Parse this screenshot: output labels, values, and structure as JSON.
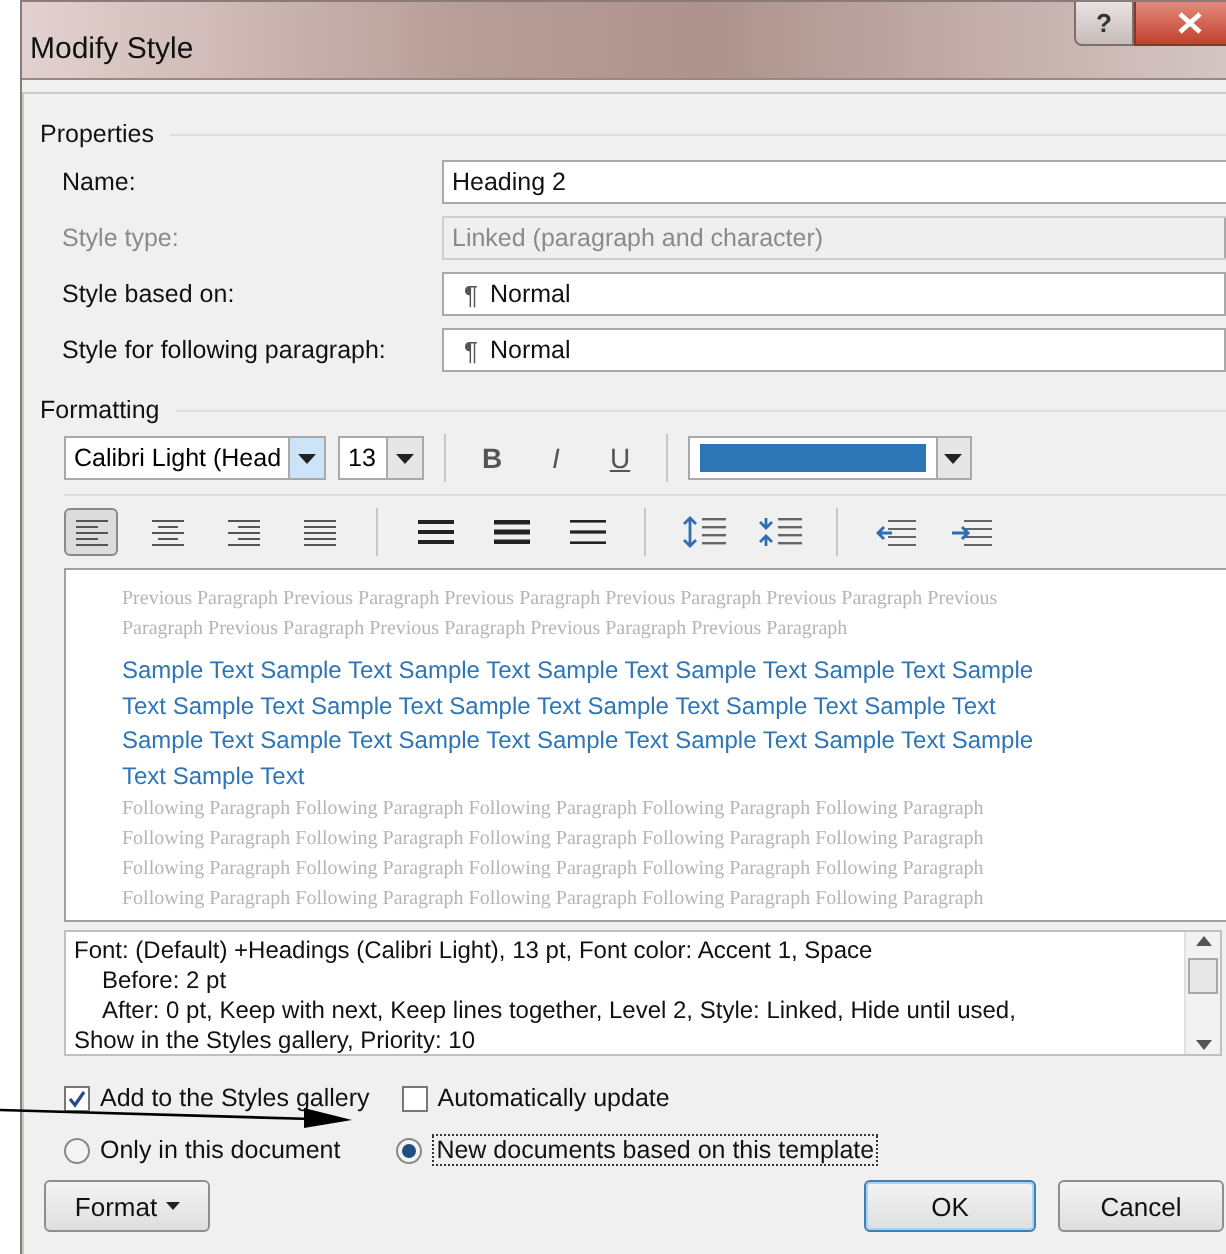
{
  "window": {
    "title": "Modify Style",
    "help_button": "?"
  },
  "properties": {
    "heading": "Properties",
    "fields": [
      {
        "label": "Name:",
        "kind": "text",
        "value": "Heading 2",
        "disabled": false
      },
      {
        "label": "Style type:",
        "kind": "combo",
        "value": "Linked (paragraph and character)",
        "disabled": true
      },
      {
        "label": "Style based on:",
        "kind": "combo",
        "icon": "¶",
        "value": "Normal",
        "disabled": false
      },
      {
        "label": "Style for following paragraph:",
        "kind": "combo",
        "icon": "¶",
        "value": "Normal",
        "disabled": false
      }
    ]
  },
  "formatting": {
    "heading": "Formatting",
    "font": "Calibri Light (Head",
    "size": "13",
    "font_styles": [
      {
        "label": "B",
        "kind": "bold"
      },
      {
        "label": "I",
        "kind": "italic"
      },
      {
        "label": "U",
        "kind": "underline"
      }
    ],
    "color": "#2e75b6",
    "alignment": [
      {
        "kind": "left",
        "selected": true
      },
      {
        "kind": "center",
        "selected": false
      },
      {
        "kind": "right",
        "selected": false
      },
      {
        "kind": "justify",
        "selected": false
      }
    ]
  },
  "preview": {
    "previous_lines": [
      "Previous Paragraph Previous Paragraph Previous Paragraph Previous Paragraph Previous Paragraph Previous",
      "Paragraph Previous Paragraph Previous Paragraph Previous Paragraph Previous Paragraph"
    ],
    "sample_lines": [
      "Sample Text Sample Text Sample Text Sample Text Sample Text Sample Text Sample",
      "Text Sample Text Sample Text Sample Text Sample Text Sample Text Sample Text",
      "Sample Text Sample Text Sample Text Sample Text Sample Text Sample Text Sample",
      "Text Sample Text"
    ],
    "following_lines": [
      "Following Paragraph Following Paragraph Following Paragraph Following Paragraph Following Paragraph",
      "Following Paragraph Following Paragraph Following Paragraph Following Paragraph Following Paragraph",
      "Following Paragraph Following Paragraph Following Paragraph Following Paragraph Following Paragraph",
      "Following Paragraph Following Paragraph Following Paragraph Following Paragraph Following Paragraph"
    ]
  },
  "description": [
    {
      "text": "Font: (Default) +Headings (Calibri Light), 13 pt, Font color: Accent 1, Space",
      "indented": false
    },
    {
      "text": "Before:  2 pt",
      "indented": true
    },
    {
      "text": "After:  0 pt, Keep with next, Keep lines together, Level 2, Style: Linked, Hide until used,",
      "indented": true
    },
    {
      "text": "Show in the Styles gallery, Priority: 10",
      "indented": false
    }
  ],
  "checkboxes": [
    {
      "label": "Add to the Styles gallery",
      "checked": true
    },
    {
      "label": "Automatically update",
      "checked": false
    }
  ],
  "radios": [
    {
      "label": "Only in this document",
      "selected": false
    },
    {
      "label": "New documents based on this template",
      "selected": true
    }
  ],
  "buttons": {
    "format": "Format",
    "ok": "OK",
    "cancel": "Cancel"
  }
}
